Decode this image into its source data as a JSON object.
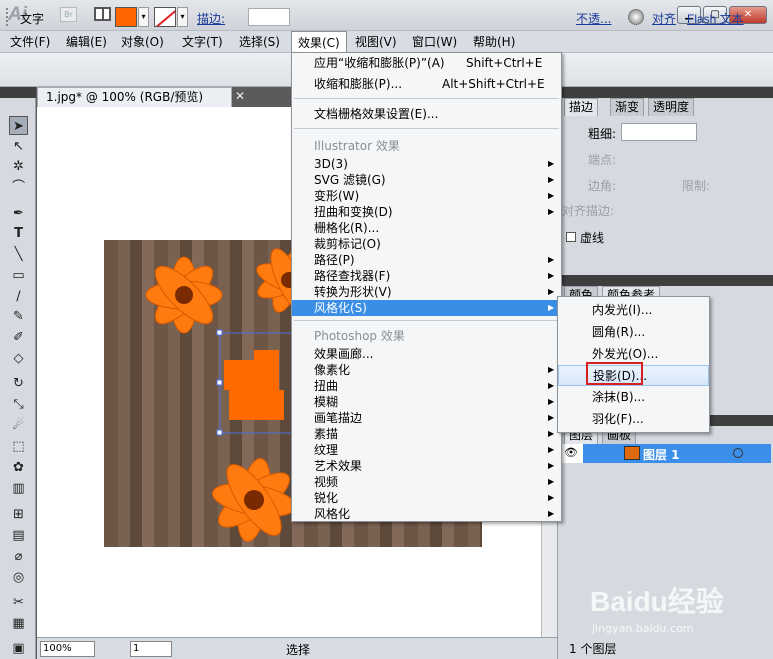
{
  "app": {
    "logo": "Ai",
    "bridge": "Br",
    "arrange_caret": "▾",
    "win_min": "▁",
    "win_max": "▢",
    "win_close": "✕"
  },
  "menubar": [
    "文件(F)",
    "编辑(E)",
    "对象(O)",
    "文字(T)",
    "选择(S)",
    "效果(C)",
    "视图(V)",
    "窗口(W)",
    "帮助(H)"
  ],
  "control": {
    "label": "文字",
    "fill_color": "#ff6600",
    "stroke_label": "描边:",
    "opacity_label": "不透...",
    "align_label": "对齐",
    "flash_label": "Flash 文本",
    "caret": "▾"
  },
  "document": {
    "tab_title": "1.jpg* @ 100% (RGB/预览)",
    "close": "✕"
  },
  "status": {
    "zoom": "100%",
    "page": "1",
    "tool": "选择"
  },
  "effect_menu": {
    "apply_last": "应用“收缩和膨胀(P)”(A)",
    "apply_last_shortcut": "Shift+Ctrl+E",
    "last_effect": "收缩和膨胀(P)...",
    "last_effect_shortcut": "Alt+Shift+Ctrl+E",
    "raster_settings": "文档栅格效果设置(E)...",
    "illustrator_header": "Illustrator 效果",
    "illustrator_items": [
      "3D(3)",
      "SVG 滤镜(G)",
      "变形(W)",
      "扭曲和变换(D)",
      "栅格化(R)...",
      "裁剪标记(O)",
      "路径(P)",
      "路径查找器(F)",
      "转换为形状(V)",
      "风格化(S)"
    ],
    "photoshop_header": "Photoshop 效果",
    "photoshop_items": [
      "效果画廊...",
      "像素化",
      "扭曲",
      "模糊",
      "画笔描边",
      "素描",
      "纹理",
      "艺术效果",
      "视频",
      "锐化",
      "风格化"
    ],
    "arrow": "▶"
  },
  "stylize_menu": [
    "内发光(I)...",
    "圆角(R)...",
    "外发光(O)...",
    "投影(D)...",
    "涂抹(B)...",
    "羽化(F)..."
  ],
  "right_panel": {
    "tabs1": [
      "描边",
      "渐变",
      "透明度"
    ],
    "weight_label": "粗细:",
    "cap_label": "端点:",
    "join_label": "边角:",
    "limit_label": "限制:",
    "align_stroke_label": "对齐描边:",
    "dashed_label": "虚线",
    "tabs2": [
      "颜色",
      "颜色参考"
    ],
    "tabs3": [
      "图层",
      "画板"
    ],
    "layer_name": "图层 1",
    "layers_count": "1 个图层"
  },
  "watermark": {
    "brand": "Baidu经验",
    "url": "jingyan.baidu.com"
  }
}
